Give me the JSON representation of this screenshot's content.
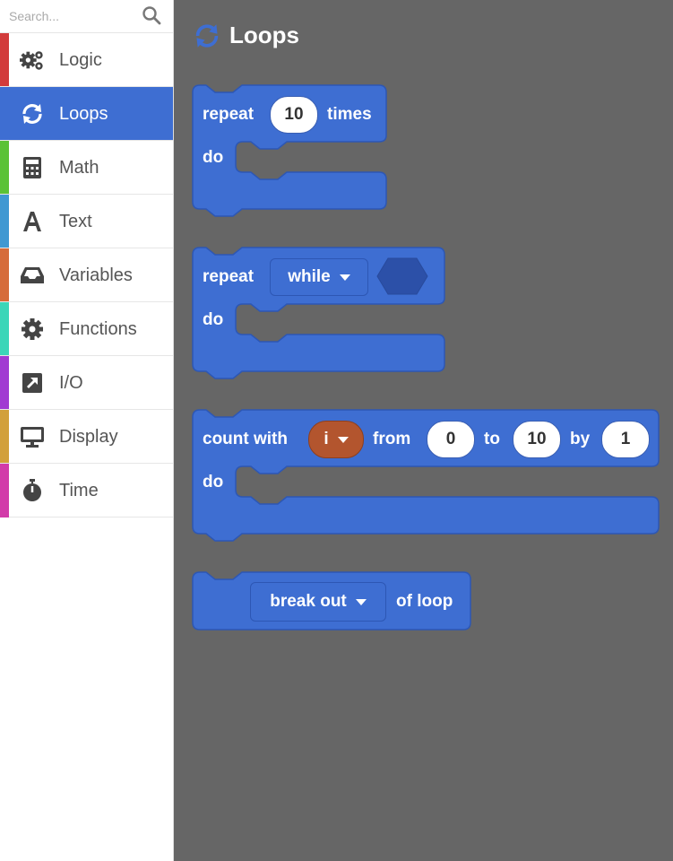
{
  "search": {
    "placeholder": "Search..."
  },
  "categories": [
    {
      "label": "Logic",
      "color": "#d23b3b",
      "icon": "gears-icon"
    },
    {
      "label": "Loops",
      "color": "#3e6ed2",
      "icon": "loop-icon"
    },
    {
      "label": "Math",
      "color": "#5bc236",
      "icon": "calculator-icon"
    },
    {
      "label": "Text",
      "color": "#3f98d2",
      "icon": "text-icon"
    },
    {
      "label": "Variables",
      "color": "#d66c3b",
      "icon": "inbox-icon"
    },
    {
      "label": "Functions",
      "color": "#3bd6b8",
      "icon": "gear-icon"
    },
    {
      "label": "I/O",
      "color": "#a13bd2",
      "icon": "arrow-out-icon"
    },
    {
      "label": "Display",
      "color": "#d2a03b",
      "icon": "monitor-icon"
    },
    {
      "label": "Time",
      "color": "#d23ba9",
      "icon": "stopwatch-icon"
    }
  ],
  "workspace": {
    "title": "Loops",
    "blocks": {
      "repeat_times": {
        "repeat": "repeat",
        "count": "10",
        "times": "times",
        "do": "do"
      },
      "repeat_while": {
        "repeat": "repeat",
        "mode": "while",
        "do": "do"
      },
      "count_with": {
        "count_with": "count with",
        "var": "i",
        "from": "from",
        "from_val": "0",
        "to": "to",
        "to_val": "10",
        "by": "by",
        "by_val": "1",
        "do": "do"
      },
      "break_out": {
        "action": "break out",
        "suffix": "of loop"
      }
    }
  },
  "colors": {
    "block": "#3e6ed2",
    "block_border": "#2d57b4",
    "selected": "#3e6ed2",
    "workspace_bg": "#666666",
    "variable": "#b3552e"
  }
}
